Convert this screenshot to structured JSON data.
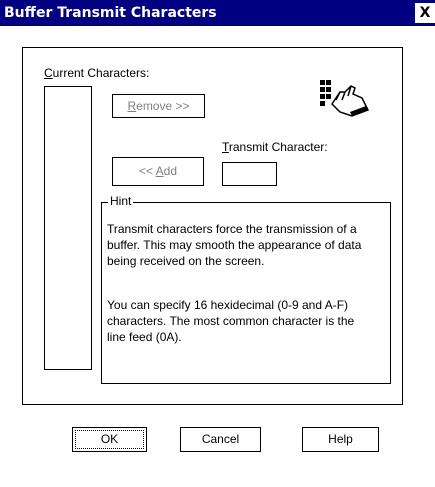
{
  "window": {
    "title": "Buffer Transmit Characters",
    "close_label": "X"
  },
  "current_characters": {
    "label_accel": "C",
    "label_rest": "urrent Characters:",
    "items": []
  },
  "remove_button": {
    "accel": "R",
    "rest": "emove >>",
    "enabled": false
  },
  "transmit_character": {
    "label_accel": "T",
    "label_rest": "ransmit Character:",
    "value": ""
  },
  "add_button": {
    "prefix": "<< ",
    "accel": "A",
    "rest": "dd",
    "enabled": false
  },
  "hint": {
    "title": "Hint",
    "paragraph1_lines": [
      "Transmit characters force the transmission of a",
      "buffer.  This may smooth the appearance of data",
      "being received on the screen."
    ],
    "paragraph2_lines": [
      "You can specify 16 hexidecimal (0-9 and A-F)",
      "characters.  The most common character is the",
      "line feed (0A)."
    ]
  },
  "footer": {
    "ok_label": "OK",
    "cancel_label": "Cancel",
    "help_label": "Help"
  },
  "icons": {
    "hand": "pointing-hand-icon"
  }
}
